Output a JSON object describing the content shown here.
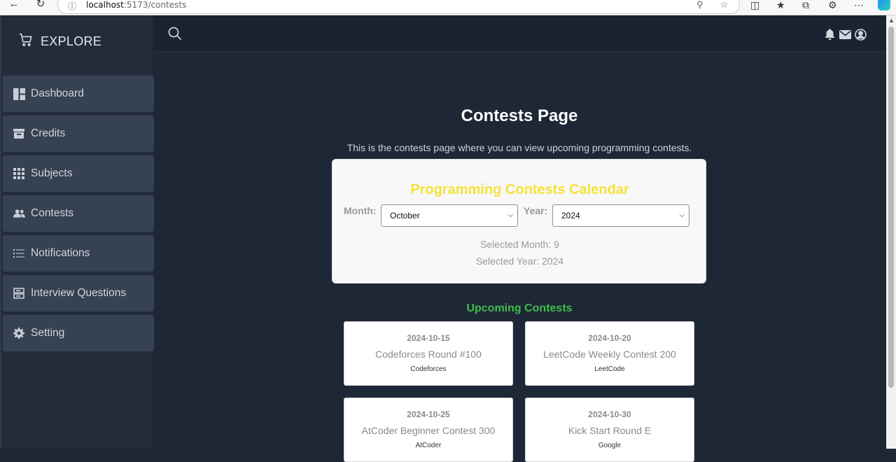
{
  "browser": {
    "url_host": "localhost",
    "url_path": ":5173/contests"
  },
  "sidebar": {
    "brand": "EXPLORE",
    "items": [
      {
        "label": "Dashboard",
        "icon": "dashboard-icon"
      },
      {
        "label": "Credits",
        "icon": "archive-icon"
      },
      {
        "label": "Subjects",
        "icon": "grid-icon"
      },
      {
        "label": "Contests",
        "icon": "users-icon"
      },
      {
        "label": "Notifications",
        "icon": "list-icon"
      },
      {
        "label": "Interview Questions",
        "icon": "server-icon"
      },
      {
        "label": "Setting",
        "icon": "gear-icon"
      }
    ]
  },
  "topbar": {
    "icons": [
      "search-icon",
      "bell-icon",
      "mail-icon",
      "user-circle-icon"
    ]
  },
  "main": {
    "title": "Contests Page",
    "description": "This is the contests page where you can view upcoming programming contests.",
    "calendar": {
      "title": "Programming Contests Calendar",
      "month_label": "Month:",
      "month_value": "October",
      "year_label": "Year:",
      "year_value": "2024",
      "selected_month": "Selected Month: 9",
      "selected_year": "Selected Year: 2024"
    },
    "upcoming_title": "Upcoming Contests",
    "contests": [
      {
        "date": "2024-10-15",
        "name": "Codeforces Round #100",
        "platform": "Codeforces"
      },
      {
        "date": "2024-10-20",
        "name": "LeetCode Weekly Contest 200",
        "platform": "LeetCode"
      },
      {
        "date": "2024-10-25",
        "name": "AtCoder Beginner Contest 300",
        "platform": "AtCoder"
      },
      {
        "date": "2024-10-30",
        "name": "Kick Start Round E",
        "platform": "Google"
      }
    ]
  },
  "colors": {
    "background": "#1e2736",
    "sidebar_item": "#364152",
    "calendar_title": "#f5e23a",
    "upcoming_title": "#3fbd4a"
  }
}
